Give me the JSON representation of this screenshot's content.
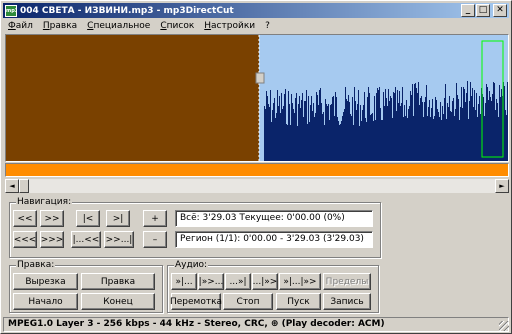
{
  "window": {
    "title": "004 СВЕТА - ИЗВИНИ.mp3 - mp3DirectCut",
    "icon": "mp3",
    "btn_min": "_",
    "btn_max": "□",
    "btn_close": "✕"
  },
  "menu": [
    "Файл",
    "Правка",
    "Специальное",
    "Список",
    "Настройки",
    "?"
  ],
  "colors": {
    "selection": "#7a4100",
    "waveform": "#0a246a",
    "background": "#a6caf0",
    "orange_bar": "#ff8c00",
    "marker": "#00ff00"
  },
  "scrollbar": {
    "left_icon": "◄",
    "right_icon": "►"
  },
  "navigation": {
    "label": "Навигация:",
    "row1": [
      "<<",
      ">>",
      "|<",
      ">|",
      "+"
    ],
    "row2": [
      "<<<",
      ">>>",
      "|...<<",
      ">>...|",
      "–"
    ],
    "info": "Всё: 3'29.03   Текущее: 0'00.00   (0%)",
    "region": "Регион (1/1): 0'00.00 - 3'29.03 (3'29.03)"
  },
  "edit": {
    "label": "Правка:",
    "cut": "Вырезка",
    "edit": "Правка",
    "start": "Начало",
    "end": "Конец"
  },
  "audio": {
    "label": "Аудио:",
    "row1": [
      "»|...",
      "|»>...",
      "...»|",
      "...|»>",
      "»|...|»>",
      "Пределы"
    ],
    "row2": [
      "Перемотка",
      "Стоп",
      "Пуск",
      "Запись"
    ]
  },
  "status": "MPEG1.0 Layer 3 - 256 kbps - 44 kHz - Stereo, CRC, ⊕    (Play decoder: ACM)"
}
